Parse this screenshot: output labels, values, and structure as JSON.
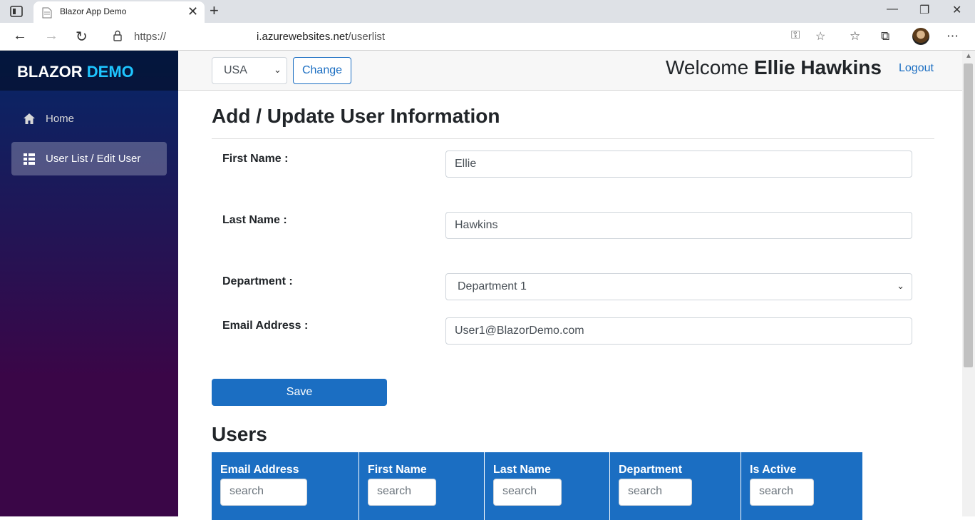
{
  "browser": {
    "tab_title": "Blazor App Demo",
    "url_prefix": "https://",
    "url_domain": "i.azurewebsites.net",
    "url_path": "/userlist"
  },
  "sidebar": {
    "brand_main": "BLAZOR",
    "brand_accent": "DEMO",
    "items": [
      {
        "label": "Home",
        "icon": "home-icon",
        "active": false
      },
      {
        "label": "User List / Edit User",
        "icon": "list-icon",
        "active": true
      }
    ]
  },
  "topbar": {
    "country": "USA",
    "change_label": "Change",
    "welcome_prefix": "Welcome",
    "user_name": "Ellie Hawkins",
    "logout_label": "Logout"
  },
  "form": {
    "title": "Add / Update User Information",
    "first_name_label": "First Name :",
    "first_name_value": "Ellie",
    "last_name_label": "Last Name :",
    "last_name_value": "Hawkins",
    "department_label": "Department :",
    "department_value": "Department 1",
    "email_label": "Email Address :",
    "email_value": "User1@BlazorDemo.com",
    "save_label": "Save"
  },
  "users": {
    "title": "Users",
    "search_placeholder": "search",
    "columns": [
      "Email Address",
      "First Name",
      "Last Name",
      "Department",
      "Is Active"
    ]
  },
  "colors": {
    "primary": "#1b6ec2",
    "brand_accent": "#1ec5ff",
    "sidebar_top": "#052767",
    "sidebar_bottom": "#3a0647"
  }
}
